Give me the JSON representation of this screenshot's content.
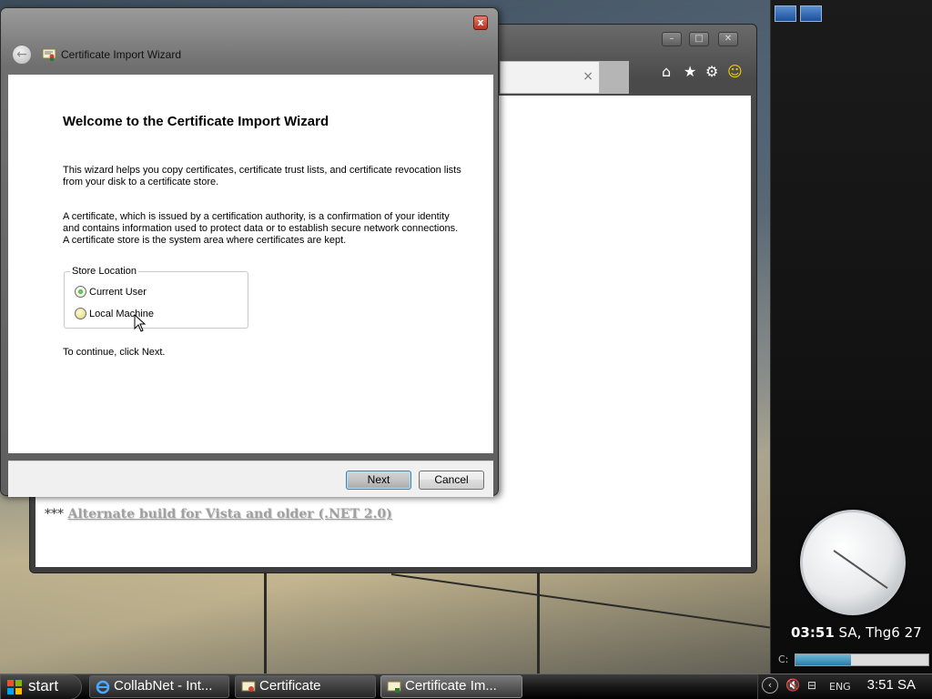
{
  "browser": {
    "tab_close": "×",
    "alt_prefix": "***",
    "alt_link": "Alternate build for Vista and older (.NET 2.0)"
  },
  "wizard": {
    "title": "Certificate Import Wizard",
    "close": "x",
    "heading": "Welcome to the Certificate Import Wizard",
    "para1": "This wizard helps you copy certificates, certificate trust lists, and certificate revocation lists from your disk to a certificate store.",
    "para2": "A certificate, which is issued by a certification authority, is a confirmation of your identity and contains information used to protect data or to establish secure network connections. A certificate store is the system area where certificates are kept.",
    "store_location": {
      "legend": "Store Location",
      "options": [
        {
          "label": "Current User",
          "selected": true
        },
        {
          "label": "Local Machine",
          "selected": false
        }
      ]
    },
    "continue_text": "To continue, click Next.",
    "next_label": "Next",
    "cancel_label": "Cancel"
  },
  "sidebar": {
    "time_bold": "03:51",
    "time_rest": " SA, Thg6 27",
    "drive_label": "C:",
    "drive_used_fraction": 0.42
  },
  "taskbar": {
    "start_label": "start",
    "items": [
      {
        "label": "CollabNet - Int...",
        "icon": "ie-icon"
      },
      {
        "label": "Certificate",
        "icon": "certificate-icon"
      },
      {
        "label": "Certificate Im...",
        "icon": "certificate-wizard-icon"
      }
    ],
    "lang": "ENG",
    "clock": "3:51 SA"
  },
  "colors": {
    "accent_blue": "#3c7fb1",
    "close_red": "#b83020",
    "radio_green": "#1d8a2a"
  }
}
